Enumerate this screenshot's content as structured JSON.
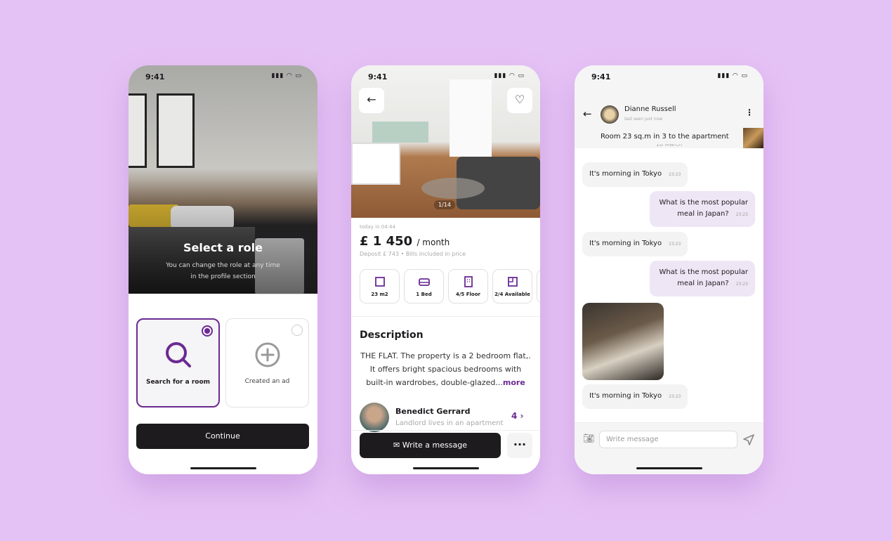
{
  "colors": {
    "accent": "#6b2a93",
    "dark": "#1e1b1f",
    "background": "#e5c2f5"
  },
  "status": {
    "time": "9:41",
    "icons": "signal wifi battery"
  },
  "role": {
    "title": "Select a role",
    "subtitle_1": "You can change the role at any time",
    "subtitle_2": "in the profile section",
    "options": [
      {
        "label": "Search for a room",
        "icon": "search-icon",
        "selected": true
      },
      {
        "label": "Created an ad",
        "icon": "plus-circle-icon",
        "selected": false
      }
    ],
    "continue": "Continue"
  },
  "listing": {
    "photo_counter": "1/14",
    "posted": "today in 04:44",
    "price": "£ 1 450",
    "period": "/ month",
    "deposit": "Deposit £ 743",
    "bills": "Bills included in price",
    "features": [
      {
        "label": "23 m2",
        "icon": "area-icon"
      },
      {
        "label": "1 Bed",
        "icon": "bed-icon"
      },
      {
        "label": "4/5 Floor",
        "icon": "building-icon"
      },
      {
        "label": "2/4 Available",
        "icon": "room-icon"
      }
    ],
    "description_title": "Description",
    "description": "THE FLAT. The property is a 2 bedroom flat,. It offers bright spacious bedrooms with built-in wardrobes, double-glazed...",
    "more": "more",
    "landlord_name": "Benedict Gerrard",
    "landlord_sub": "Landlord lives in an apartment",
    "landlord_count": "4",
    "write": "Write a message"
  },
  "chat": {
    "name": "Dianne Russell",
    "last_seen": "last seen just now",
    "pinned": "Room 23 sq.m in 3 to the apartment",
    "date": "10 March",
    "messages": [
      {
        "text": "It's morning in Tokyo",
        "time": "23:23",
        "me": false
      },
      {
        "text": "What is the most popular meal in Japan?",
        "time": "23:23",
        "me": true
      },
      {
        "text": "It's morning in Tokyo",
        "time": "23:23",
        "me": false
      },
      {
        "text": "What is the most popular meal in Japan?",
        "time": "23:23",
        "me": true
      },
      {
        "text": "It's morning in Tokyo",
        "time": "23:23",
        "me": false
      }
    ],
    "placeholder": "Write message"
  }
}
